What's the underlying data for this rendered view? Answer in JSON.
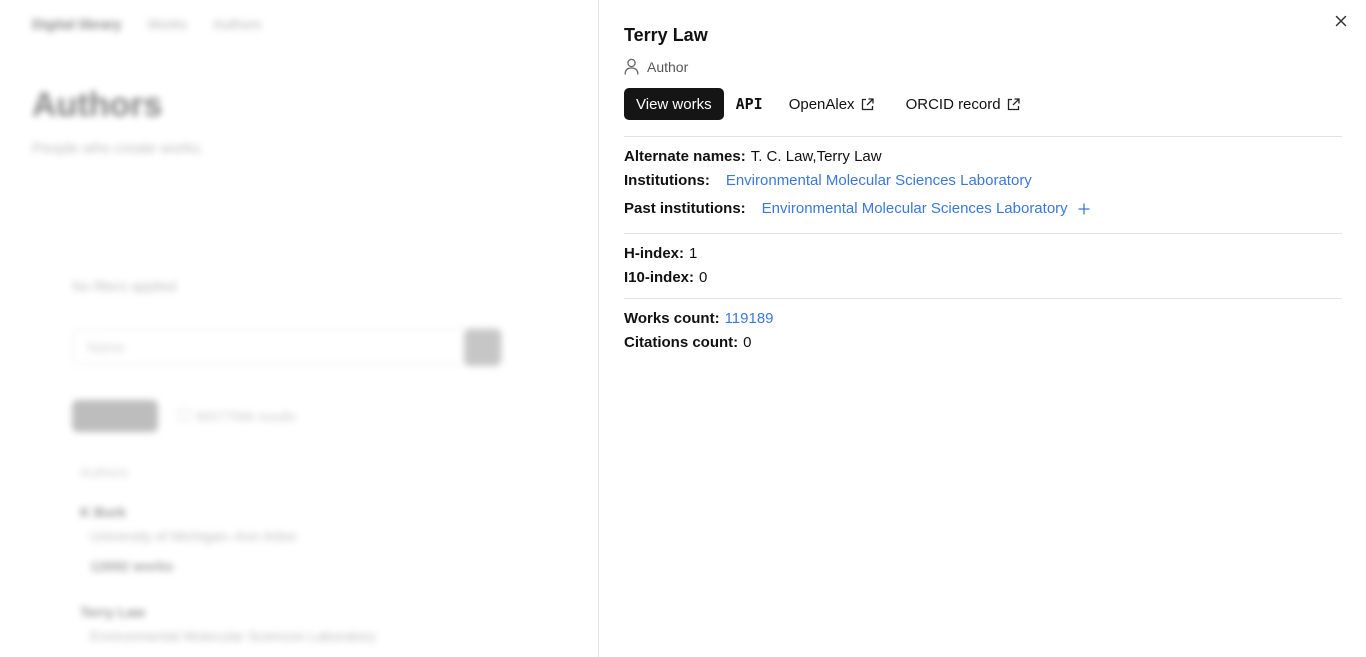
{
  "background": {
    "brand": "Digital library",
    "nav": [
      "Works",
      "Authors"
    ],
    "title": "Authors",
    "subtitle": "People who create works.",
    "filters_label": "No filters applied",
    "search_placeholder": "Name",
    "count_text": "90577586 results",
    "column_header": "Authors",
    "items": [
      {
        "name": "K Burk",
        "institution": "University of Michigan–Ann Arbor",
        "works": "12692 works"
      },
      {
        "name": "Terry Law",
        "institution": "Environmental Molecular Sciences Laboratory"
      }
    ]
  },
  "drawer": {
    "name": "Terry Law",
    "role": "Author",
    "actions": {
      "view_works": "View works",
      "api": "API",
      "openalex": "OpenAlex",
      "orcid": "ORCID record"
    },
    "fields": {
      "alternate_names_label": "Alternate names:",
      "alternate_names_value": "T. C. Law,Terry Law",
      "institutions_label": "Institutions:",
      "institutions_value": "Environmental Molecular Sciences Laboratory",
      "past_institutions_label": "Past institutions:",
      "past_institutions_value": "Environmental Molecular Sciences Laboratory",
      "h_index_label": "H-index:",
      "h_index_value": "1",
      "i10_index_label": "I10-index:",
      "i10_index_value": "0",
      "works_count_label": "Works count:",
      "works_count_value": "119189",
      "citations_count_label": "Citations count:",
      "citations_count_value": "0"
    },
    "icons": {
      "close": "close-icon",
      "role": "user-icon",
      "external": "external-link-icon",
      "expand": "plus-icon"
    },
    "colors": {
      "link": "#3b78d8",
      "primary_button": "#151515"
    }
  }
}
